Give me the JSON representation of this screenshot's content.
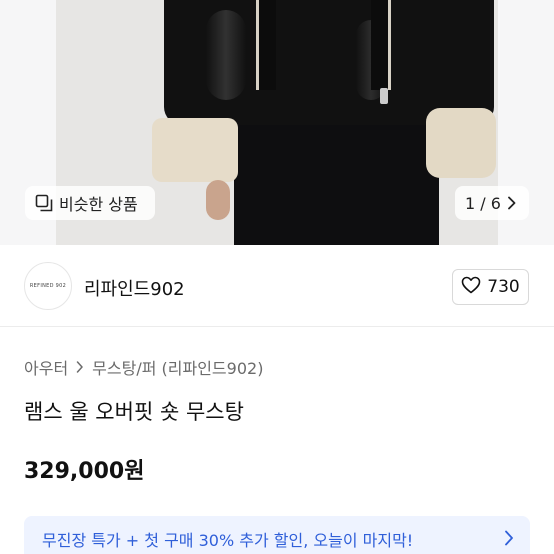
{
  "gallery": {
    "similar_label": "비슷한 상품",
    "pager": "1 / 6",
    "icons": {
      "similar": "similar-items-icon",
      "next": "chevron-right-icon"
    }
  },
  "seller": {
    "logo_text": "REFINED 902",
    "name": "리파인드902",
    "likes": "730"
  },
  "breadcrumb": {
    "category": "아우터",
    "subcategory": "무스탕/퍼 (리파인드902)"
  },
  "product": {
    "title": "램스 울 오버핏 숏 무스탕",
    "price": "329,000원"
  },
  "promo": {
    "text": "무진장 특가 + 첫 구매 30% 추가 할인, 오늘이 마지막!",
    "color": "#2f5fd9",
    "background": "#eef3ff"
  }
}
